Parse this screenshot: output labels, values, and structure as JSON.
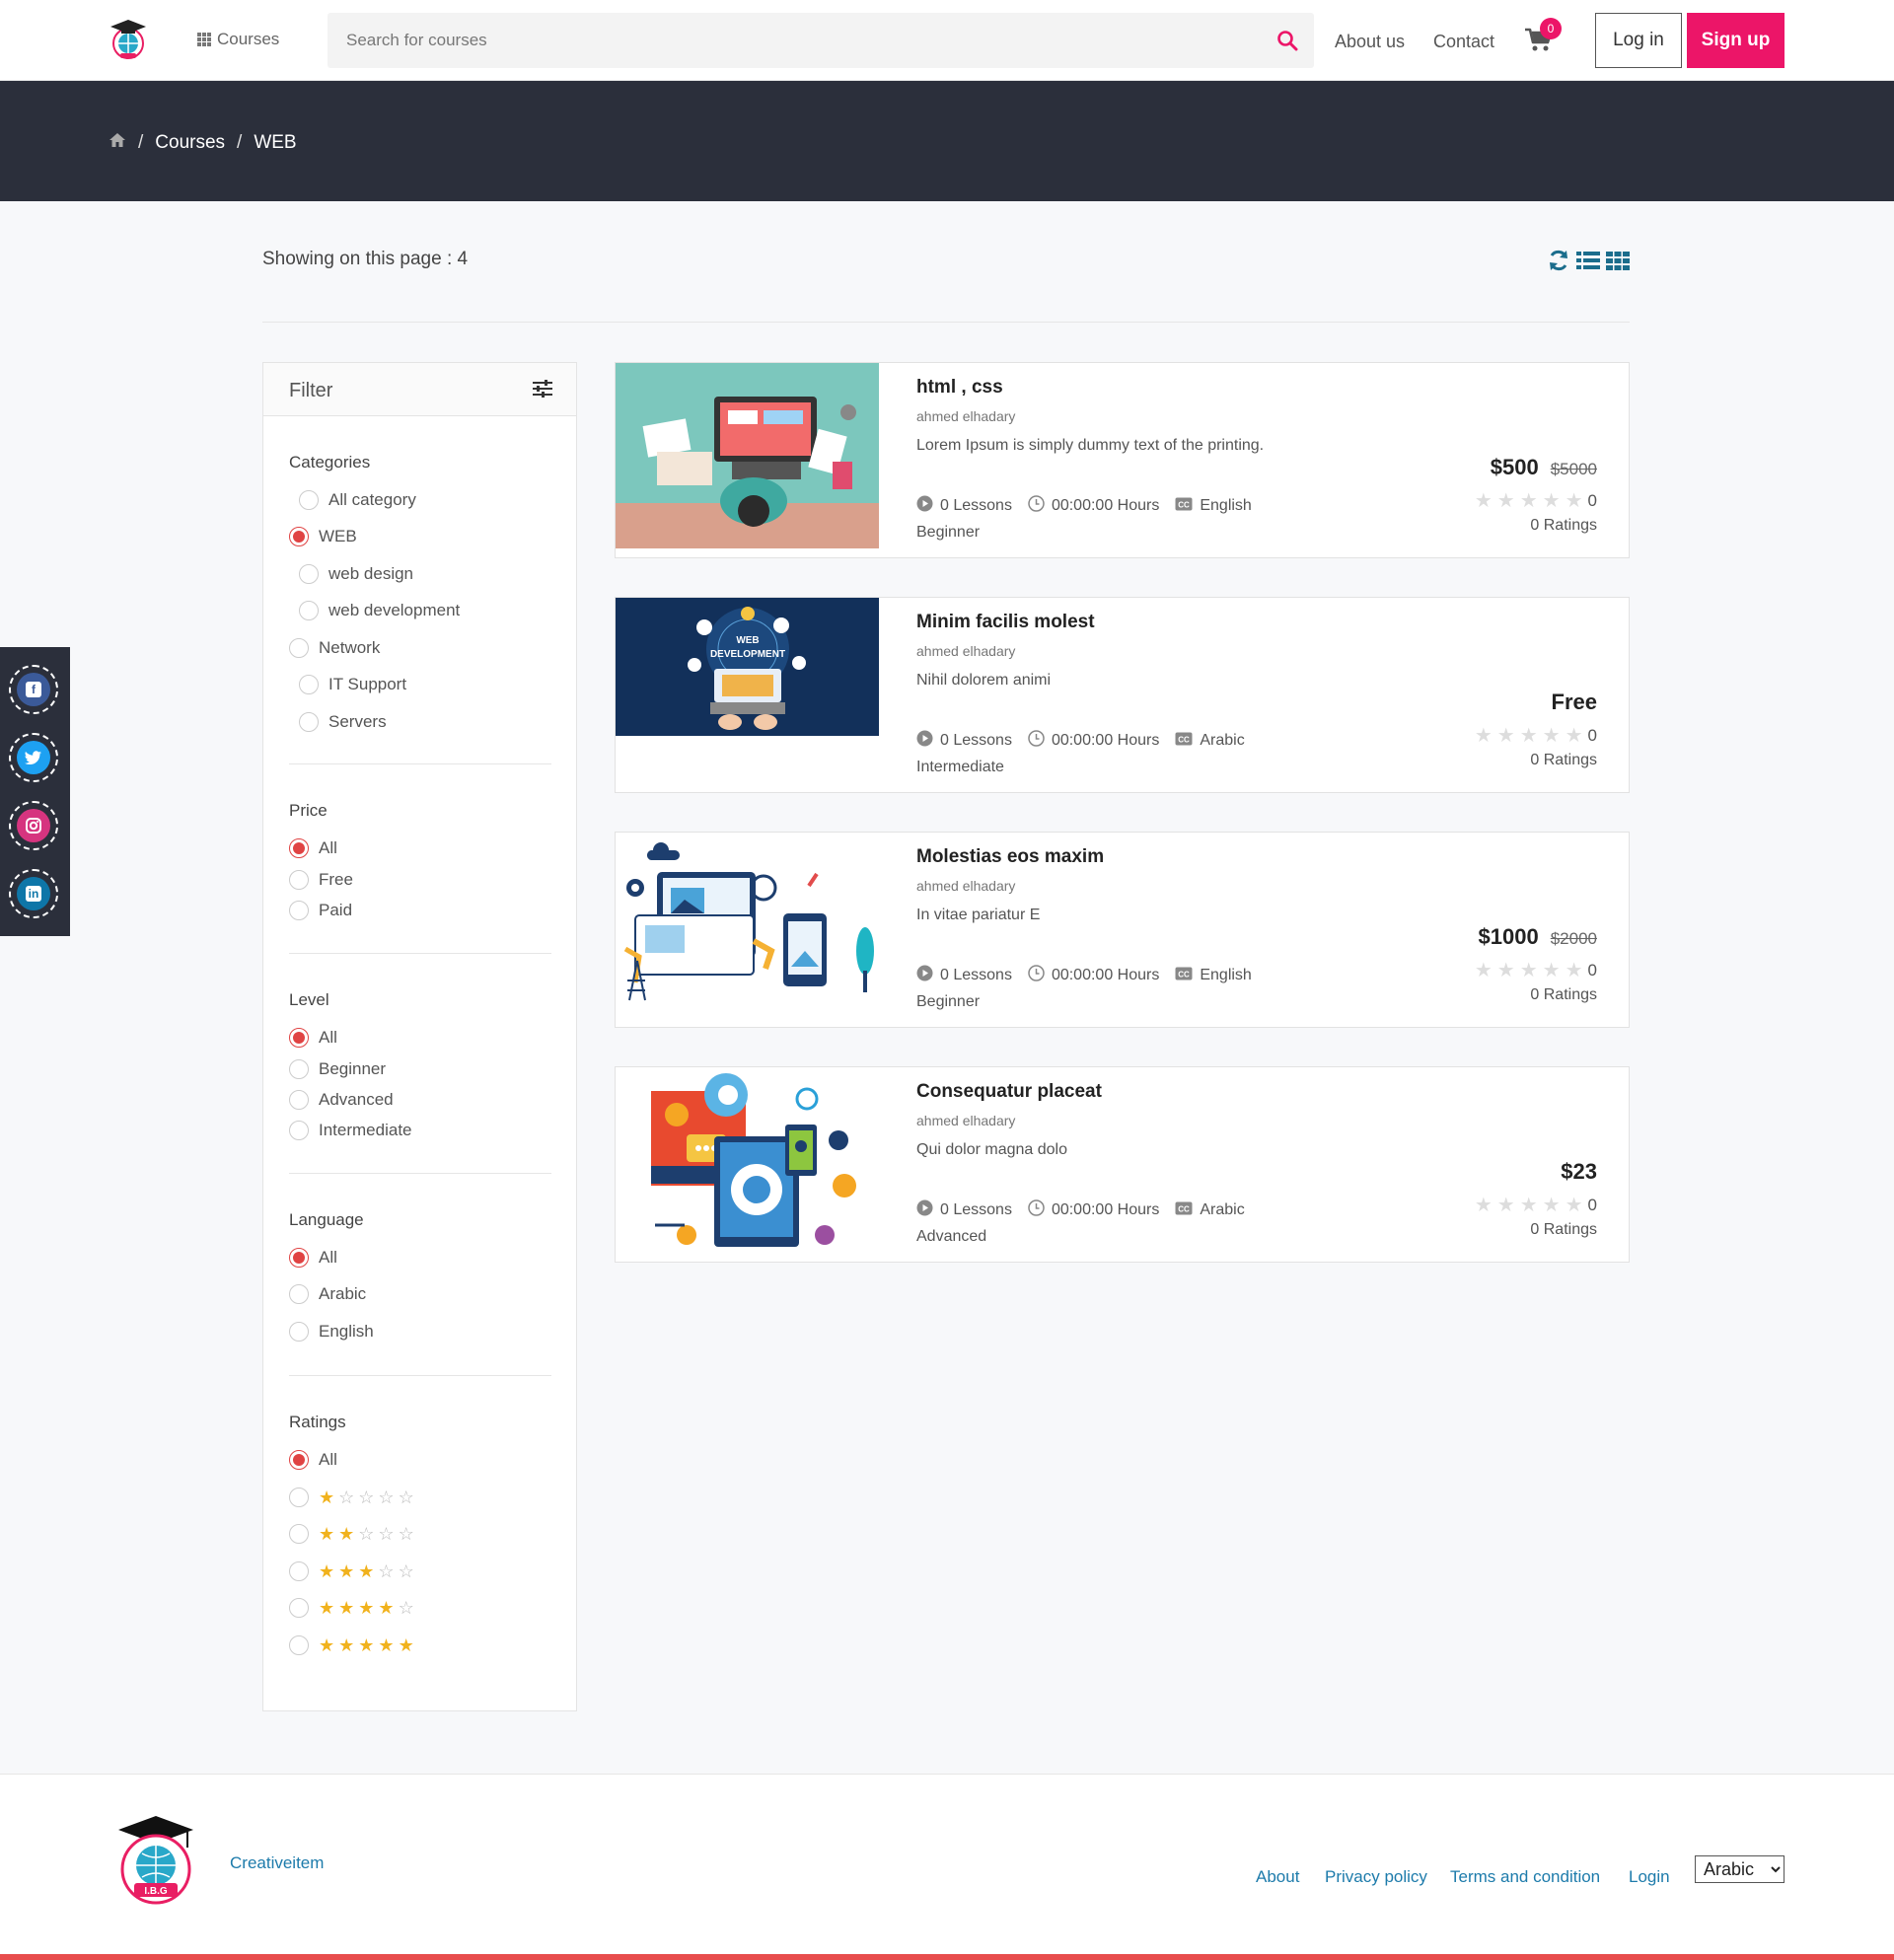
{
  "header": {
    "courses_label": "Courses",
    "search_placeholder": "Search for courses",
    "nav": [
      "About us",
      "Contact"
    ],
    "cart_count": "0",
    "login_label": "Log in",
    "signup_label": "Sign up",
    "accent_color": "#ec1568"
  },
  "breadcrumb": {
    "home_icon": "home-icon",
    "items": [
      "Courses",
      "WEB"
    ]
  },
  "listing": {
    "showing_text": "Showing on this page : 4"
  },
  "filter": {
    "title": "Filter",
    "categories": {
      "title": "Categories",
      "options": [
        {
          "label": "All category",
          "selected": false
        },
        {
          "label": "WEB",
          "selected": true
        },
        {
          "label": "web design",
          "selected": false
        },
        {
          "label": "web development",
          "selected": false
        },
        {
          "label": "Network",
          "selected": false
        },
        {
          "label": "IT Support",
          "selected": false
        },
        {
          "label": "Servers",
          "selected": false
        }
      ]
    },
    "price": {
      "title": "Price",
      "options": [
        {
          "label": "All",
          "selected": true
        },
        {
          "label": "Free",
          "selected": false
        },
        {
          "label": "Paid",
          "selected": false
        }
      ]
    },
    "level": {
      "title": "Level",
      "options": [
        {
          "label": "All",
          "selected": true
        },
        {
          "label": "Beginner",
          "selected": false
        },
        {
          "label": "Advanced",
          "selected": false
        },
        {
          "label": "Intermediate",
          "selected": false
        }
      ]
    },
    "language": {
      "title": "Language",
      "options": [
        {
          "label": "All",
          "selected": true
        },
        {
          "label": "Arabic",
          "selected": false
        },
        {
          "label": "English",
          "selected": false
        }
      ]
    },
    "ratings": {
      "title": "Ratings",
      "all_label": "All",
      "star_options": [
        1,
        2,
        3,
        4,
        5
      ]
    }
  },
  "courses": [
    {
      "title": "html , css",
      "author": "ahmed elhadary",
      "description": "Lorem Ipsum is simply dummy text of the printing.",
      "lessons": "0 Lessons",
      "hours": "00:00:00 Hours",
      "language": "English",
      "level": "Beginner",
      "price": "$500",
      "old_price": "$5000",
      "rating_value": "0",
      "ratings_count": "0 Ratings"
    },
    {
      "title": "Minim facilis molest",
      "author": "ahmed elhadary",
      "description": "Nihil dolorem animi",
      "lessons": "0 Lessons",
      "hours": "00:00:00 Hours",
      "language": "Arabic",
      "level": "Intermediate",
      "price": "Free",
      "old_price": "",
      "rating_value": "0",
      "ratings_count": "0 Ratings",
      "image_text": [
        "WEB",
        "DEVELOPMENT"
      ]
    },
    {
      "title": "Molestias eos maxim",
      "author": "ahmed elhadary",
      "description": "In vitae pariatur E",
      "lessons": "0 Lessons",
      "hours": "00:00:00 Hours",
      "language": "English",
      "level": "Beginner",
      "price": "$1000",
      "old_price": "$2000",
      "rating_value": "0",
      "ratings_count": "0 Ratings"
    },
    {
      "title": "Consequatur placeat",
      "author": "ahmed elhadary",
      "description": "Qui dolor magna dolo",
      "lessons": "0 Lessons",
      "hours": "00:00:00 Hours",
      "language": "Arabic",
      "level": "Advanced",
      "price": "$23",
      "old_price": "",
      "rating_value": "0",
      "ratings_count": "0 Ratings"
    }
  ],
  "social": [
    "facebook-icon",
    "twitter-icon",
    "instagram-icon",
    "linkedin-icon"
  ],
  "footer": {
    "brand": "Creativeitem",
    "links": [
      "About",
      "Privacy policy",
      "Terms and condition",
      "Login"
    ],
    "language_selected": "Arabic",
    "logo_text": "I.B.G"
  }
}
